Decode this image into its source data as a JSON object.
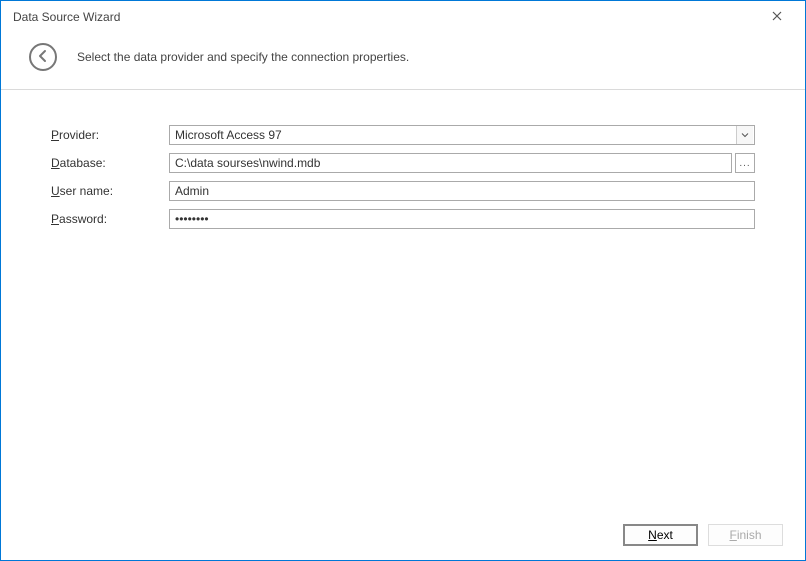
{
  "window": {
    "title": "Data Source Wizard"
  },
  "header": {
    "subtitle": "Select the data provider and specify the connection properties."
  },
  "form": {
    "provider": {
      "label_pre": "P",
      "label_post": "rovider:",
      "value": "Microsoft Access 97"
    },
    "database": {
      "label_pre": "D",
      "label_post": "atabase:",
      "value": "C:\\data sourses\\nwind.mdb"
    },
    "username": {
      "label_pre": "U",
      "label_post": "ser name:",
      "value": "Admin"
    },
    "password": {
      "label_pre": "P",
      "label_post": "assword:",
      "value": "••••••••"
    }
  },
  "footer": {
    "next_pre": "N",
    "next_post": "ext",
    "finish_pre": "F",
    "finish_post": "inish"
  },
  "icons": {
    "browse": "..."
  }
}
